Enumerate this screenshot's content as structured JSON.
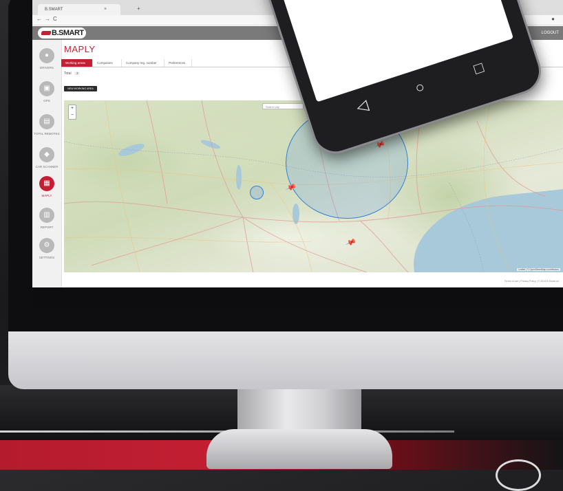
{
  "browser": {
    "tab_title": "B.SMART",
    "tab_close": "×",
    "new_tab": "+",
    "back": "←",
    "forward": "→",
    "reload": "C"
  },
  "app": {
    "logo": "B.SMART",
    "logout": "LOGOUT",
    "page_title": "MAPLY"
  },
  "sidebar": {
    "items": [
      {
        "label": "Drivers",
        "icon": "driver-icon",
        "glyph": "●",
        "active": false
      },
      {
        "label": "GPS",
        "icon": "gps-icon",
        "glyph": "▣",
        "active": false
      },
      {
        "label": "Total Remotes",
        "icon": "remotes-icon",
        "glyph": "▤",
        "active": false
      },
      {
        "label": "Car Scanner",
        "icon": "car-icon",
        "glyph": "◆",
        "active": false
      },
      {
        "label": "Maply",
        "icon": "map-icon",
        "glyph": "▦",
        "active": true
      },
      {
        "label": "Report",
        "icon": "report-icon",
        "glyph": "▥",
        "active": false
      },
      {
        "label": "Settings",
        "icon": "settings-icon",
        "glyph": "⚙",
        "active": false
      }
    ]
  },
  "tabs": [
    {
      "label": "Working areas",
      "active": true
    },
    {
      "label": "Companies",
      "active": false
    },
    {
      "label": "Company reg. number",
      "active": false
    },
    {
      "label": "Preferences",
      "active": false
    }
  ],
  "total": {
    "label": "Total",
    "count": "3"
  },
  "new_area_button": "NEW WORKING AREA",
  "map": {
    "zoom_in": "+",
    "zoom_out": "−",
    "search_placeholder": "Search city",
    "attribution": "Leaflet | © OpenStreetMap contributors",
    "pin_glyph": "📌"
  },
  "footer": "Terms of use  |  Privacy Policy  |  © 2019 B.Smart srl",
  "phone_nav": {
    "back": "◁",
    "home": "○",
    "recents": "□"
  },
  "colors": {
    "accent": "#c41f33",
    "circle": "#2f80d6",
    "sidebar_icon": "#b9b9b9"
  }
}
